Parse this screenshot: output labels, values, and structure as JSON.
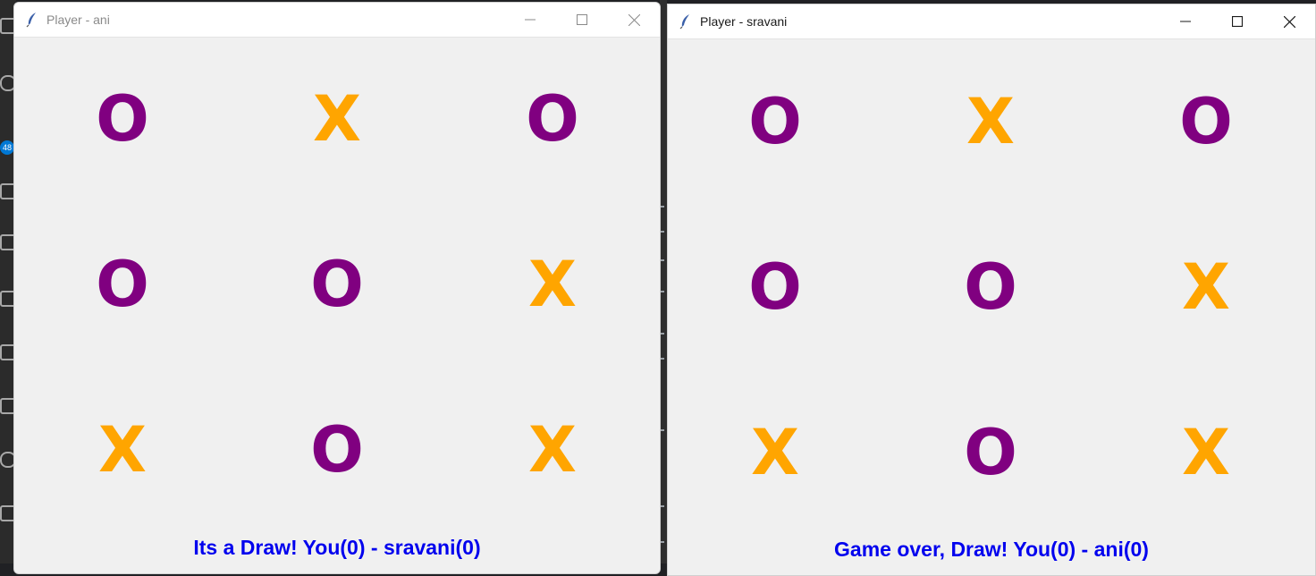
{
  "colors": {
    "o_mark": "#800080",
    "x_mark": "#ffa500",
    "status_text": "#0000ee"
  },
  "background": {
    "badge": "48"
  },
  "windows": [
    {
      "title": "Player - ani",
      "board": [
        [
          "O",
          "X",
          "O"
        ],
        [
          "O",
          "O",
          "X"
        ],
        [
          "X",
          "O",
          "X"
        ]
      ],
      "status": "Its a Draw! You(0) - sravani(0)"
    },
    {
      "title": "Player - sravani",
      "board": [
        [
          "O",
          "X",
          "O"
        ],
        [
          "O",
          "O",
          "X"
        ],
        [
          "X",
          "O",
          "X"
        ]
      ],
      "status": "Game over, Draw! You(0) - ani(0)"
    }
  ]
}
